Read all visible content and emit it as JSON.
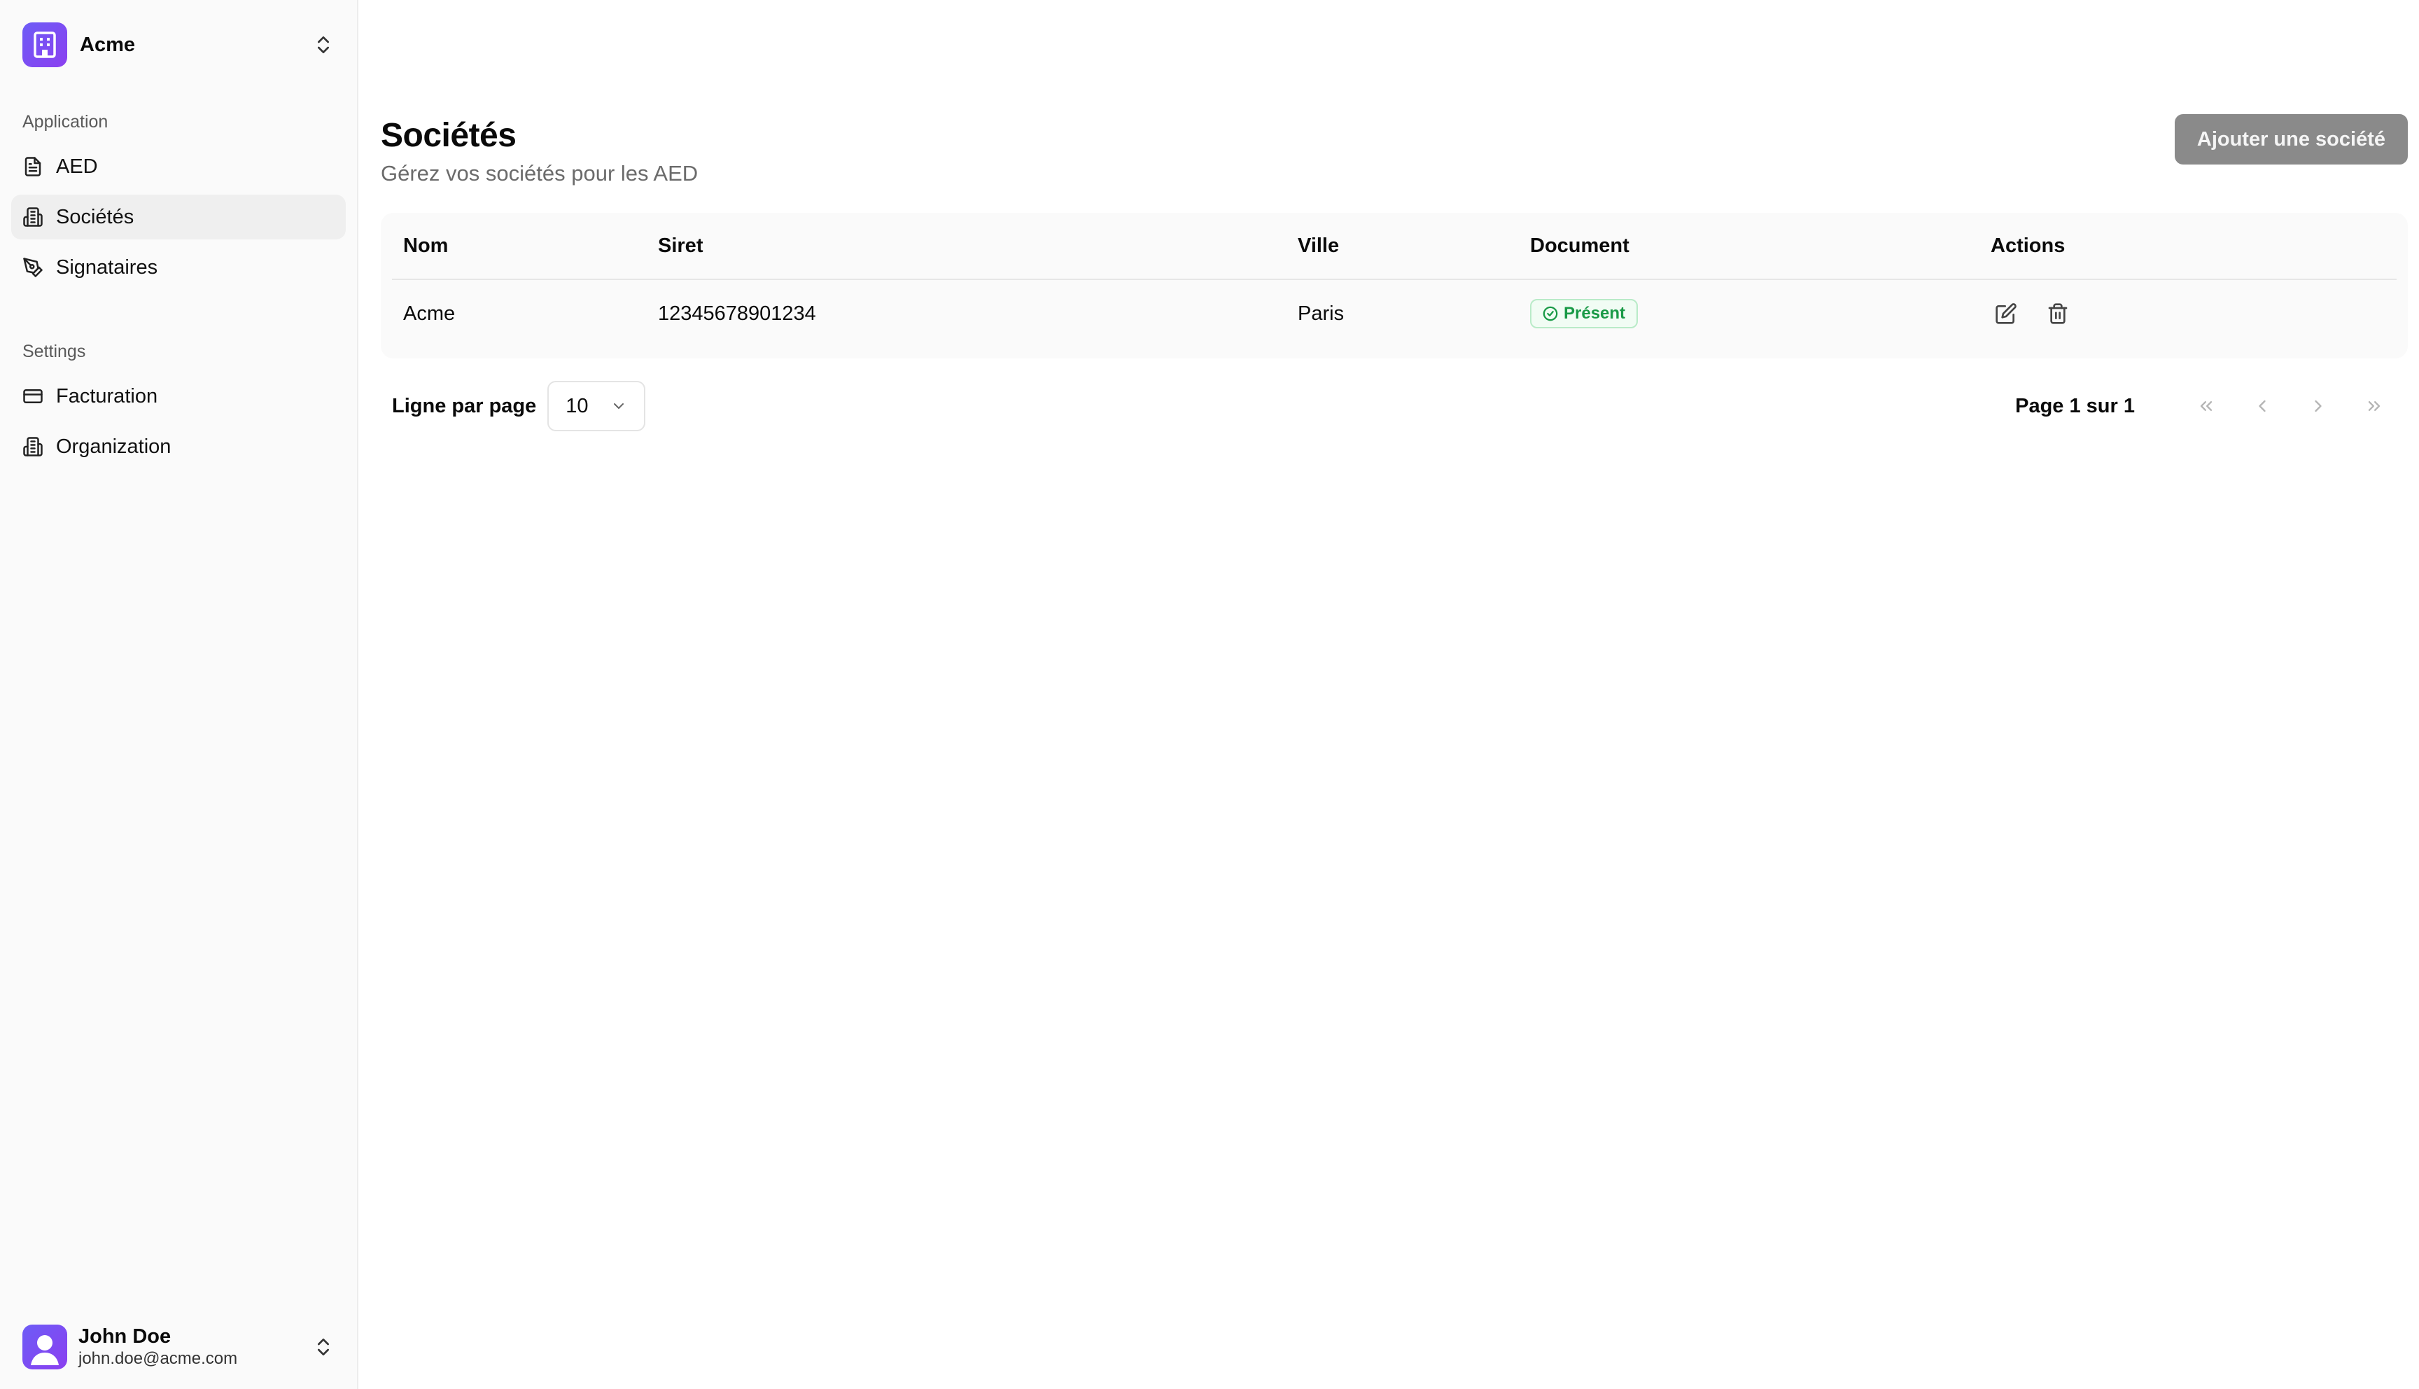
{
  "sidebar": {
    "org": {
      "name": "Acme",
      "logo_icon": "building-icon"
    },
    "groups": [
      {
        "label": "Application",
        "items": [
          {
            "label": "AED",
            "icon": "file-text-icon",
            "active": false
          },
          {
            "label": "Sociétés",
            "icon": "building-icon",
            "active": true
          },
          {
            "label": "Signataires",
            "icon": "pen-tool-icon",
            "active": false
          }
        ]
      },
      {
        "label": "Settings",
        "items": [
          {
            "label": "Facturation",
            "icon": "credit-card-icon",
            "active": false
          },
          {
            "label": "Organization",
            "icon": "building-icon",
            "active": false
          }
        ]
      }
    ],
    "user": {
      "name": "John Doe",
      "email": "john.doe@acme.com"
    }
  },
  "page": {
    "title": "Sociétés",
    "subtitle": "Gérez vos sociétés pour les AED",
    "add_button_label": "Ajouter une société"
  },
  "table": {
    "columns": [
      "Nom",
      "Siret",
      "Ville",
      "Document",
      "Actions"
    ],
    "rows": [
      {
        "nom": "Acme",
        "siret": "12345678901234",
        "ville": "Paris",
        "document": "Présent"
      }
    ]
  },
  "pagination": {
    "rows_label": "Ligne par page",
    "rows_per_page": "10",
    "page_info": "Page 1 sur 1"
  },
  "colors": {
    "accent": "#7c4dff",
    "badge_green": "#1a9a47",
    "button_disabled": "#8a8a8a"
  }
}
